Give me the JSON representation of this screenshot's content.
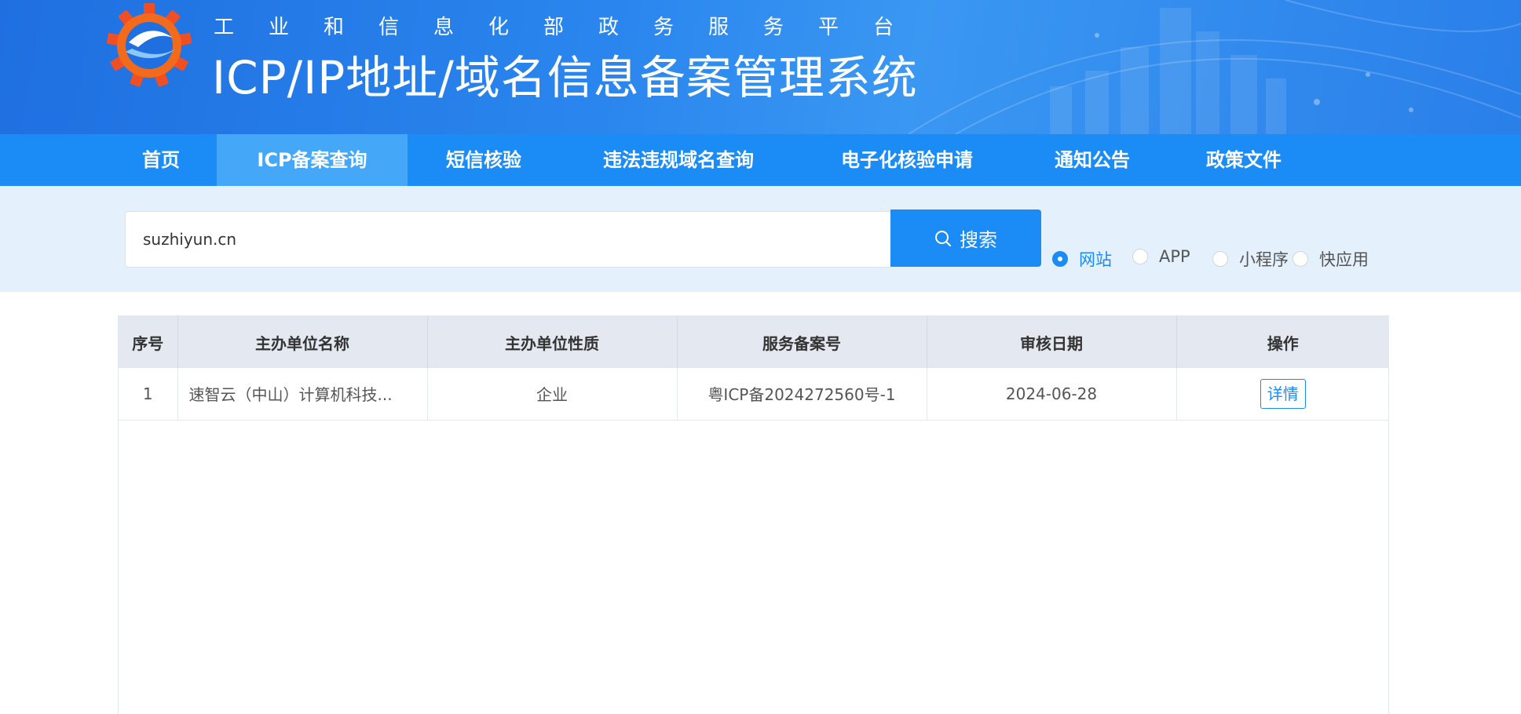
{
  "header": {
    "subtitle": "工业和信息化部政务服务平台",
    "title": "ICP/IP地址/域名信息备案管理系统"
  },
  "nav": {
    "items": [
      {
        "label": "首页"
      },
      {
        "label": "ICP备案查询"
      },
      {
        "label": "短信核验"
      },
      {
        "label": "违法违规域名查询"
      },
      {
        "label": "电子化核验申请"
      },
      {
        "label": "通知公告"
      },
      {
        "label": "政策文件"
      }
    ],
    "active": "ICP备案查询"
  },
  "search": {
    "value": "suzhiyun.cn",
    "button_label": "搜索",
    "options": [
      {
        "label": "网站",
        "checked": true
      },
      {
        "label": "APP",
        "checked": false
      },
      {
        "label": "小程序",
        "checked": false
      },
      {
        "label": "快应用",
        "checked": false
      }
    ]
  },
  "table": {
    "headers": [
      "序号",
      "主办单位名称",
      "主办单位性质",
      "服务备案号",
      "审核日期",
      "操作"
    ],
    "rows": [
      {
        "index": "1",
        "org_name": "速智云（中山）计算机科技...",
        "org_type": "企业",
        "record_no": "粤ICP备2024272560号-1",
        "date": "2024-06-28",
        "action": "详情"
      }
    ]
  },
  "colors": {
    "primary": "#1b8cf6",
    "nav_active": "#44a7f8",
    "search_band": "#e4f1fd",
    "table_header": "#e3e8f1"
  }
}
